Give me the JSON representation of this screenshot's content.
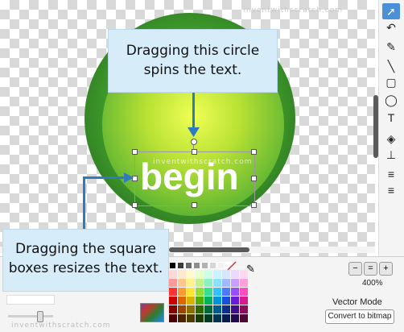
{
  "watermarks": {
    "top": "inventwithscratch.com",
    "bottom": "inventwithscratch.com",
    "selection": "inventwithscratch.com"
  },
  "canvas": {
    "text_object": "begin"
  },
  "callouts": {
    "rotate": "Dragging this circle spins the text.",
    "resize": "Dragging the square boxes resizes the text."
  },
  "tools": [
    {
      "name": "select",
      "icon": "arrow-pointer-icon",
      "glyph": "➚",
      "active": true
    },
    {
      "name": "reshape",
      "icon": "reshape-icon",
      "glyph": "↶",
      "active": false
    },
    {
      "name": "pencil",
      "icon": "pencil-icon",
      "glyph": "✎",
      "active": false
    },
    {
      "name": "line",
      "icon": "line-icon",
      "glyph": "╲",
      "active": false
    },
    {
      "name": "rectangle",
      "icon": "rectangle-icon",
      "glyph": "▢",
      "active": false
    },
    {
      "name": "ellipse",
      "icon": "ellipse-icon",
      "glyph": "◯",
      "active": false
    },
    {
      "name": "text",
      "icon": "text-icon",
      "glyph": "T",
      "active": false
    },
    {
      "name": "fill",
      "icon": "paint-bucket-icon",
      "glyph": "◈",
      "active": false
    },
    {
      "name": "stamp",
      "icon": "stamp-icon",
      "glyph": "⊥",
      "active": false
    },
    {
      "name": "forward-layer",
      "icon": "forward-layer-icon",
      "glyph": "≡",
      "active": false
    },
    {
      "name": "back-layer",
      "icon": "back-layer-icon",
      "glyph": "≡",
      "active": false
    }
  ],
  "zoom": {
    "out_glyph": "−",
    "reset_glyph": "=",
    "in_glyph": "+",
    "level": "400%"
  },
  "mode": {
    "label": "Vector Mode",
    "convert_button": "Convert to bitmap"
  },
  "colors": {
    "top_row": [
      "#000000",
      "#3a3a3a",
      "#6b6b6b",
      "#8f8f8f",
      "#b3b3b3",
      "#d6d6d6",
      "#f2f2f2",
      "#ffffff"
    ],
    "palette": [
      "#ffd9d9",
      "#ffe9cc",
      "#fffacc",
      "#e6ffcc",
      "#ccffe6",
      "#ccf2ff",
      "#d9e6ff",
      "#ecd9ff",
      "#ffd9f2",
      "#ff9999",
      "#ffc78a",
      "#fff28a",
      "#c2f28a",
      "#8af2c2",
      "#8ae0ff",
      "#9fb8ff",
      "#c89fff",
      "#ff9fd9",
      "#ff3333",
      "#ff9933",
      "#ffe433",
      "#8fe033",
      "#33e08f",
      "#33c2ff",
      "#4d7aff",
      "#9a4dff",
      "#ff4dbf",
      "#cc0000",
      "#e06600",
      "#d9b300",
      "#4fb000",
      "#00b35c",
      "#0095d9",
      "#1a4fd9",
      "#6a1ad9",
      "#d91a8f",
      "#800000",
      "#994400",
      "#8a7000",
      "#2e6600",
      "#006b38",
      "#005c8a",
      "#0f2f8a",
      "#3f0f8a",
      "#8a0f5a",
      "#4d0000",
      "#4d2200",
      "#4d3e00",
      "#1a3a00",
      "#003d20",
      "#00334d",
      "#0a1a4d",
      "#22084d",
      "#4d0833"
    ]
  }
}
